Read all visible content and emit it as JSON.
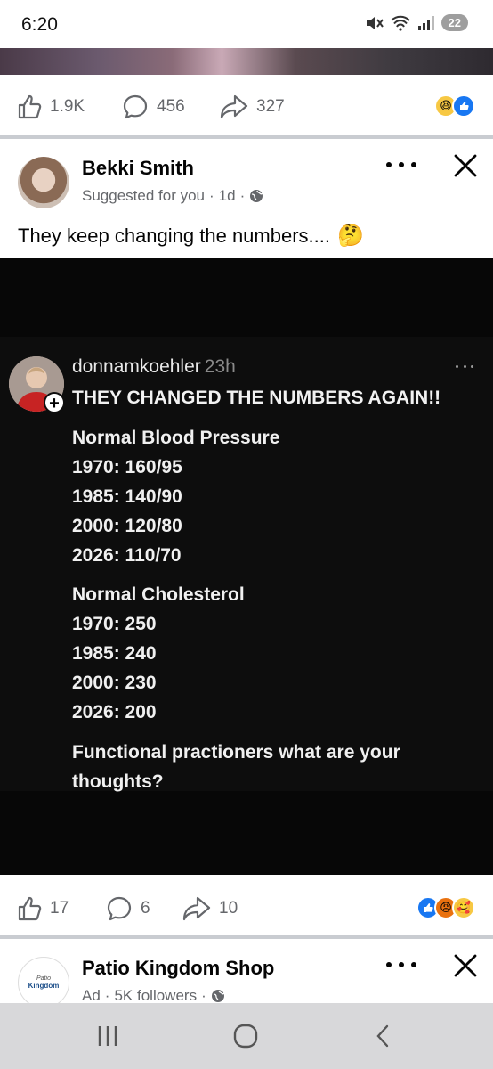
{
  "status": {
    "time": "6:20",
    "battery": "22"
  },
  "prev_post": {
    "likes": "1.9K",
    "comments": "456",
    "shares": "327"
  },
  "post": {
    "author": "Bekki Smith",
    "suggested": "Suggested for you",
    "age": "1d",
    "text": "They keep changing the numbers....",
    "embedded": {
      "username": "donnamkoehler",
      "time": "23h",
      "headline": "THEY CHANGED THE NUMBERS AGAIN!!",
      "lines": [
        "Normal Blood Pressure",
        "1970: 160/95",
        "1985: 140/90",
        "2000: 120/80",
        "2026: 110/70",
        "Normal Cholesterol",
        "1970: 250",
        "1985: 240",
        "2000: 230",
        "2026: 200",
        "Functional practioners what are your",
        "thoughts?"
      ]
    },
    "likes": "17",
    "comments": "6",
    "shares": "10"
  },
  "next_post": {
    "author": "Patio Kingdom Shop",
    "logo_text_1": "Patio",
    "logo_text_2": "Kingdom",
    "type": "Ad",
    "followers": "5K followers"
  },
  "colors": {
    "facebook_blue": "#1877f2",
    "gray_text": "#65676b",
    "divider": "#c9ccd1"
  }
}
